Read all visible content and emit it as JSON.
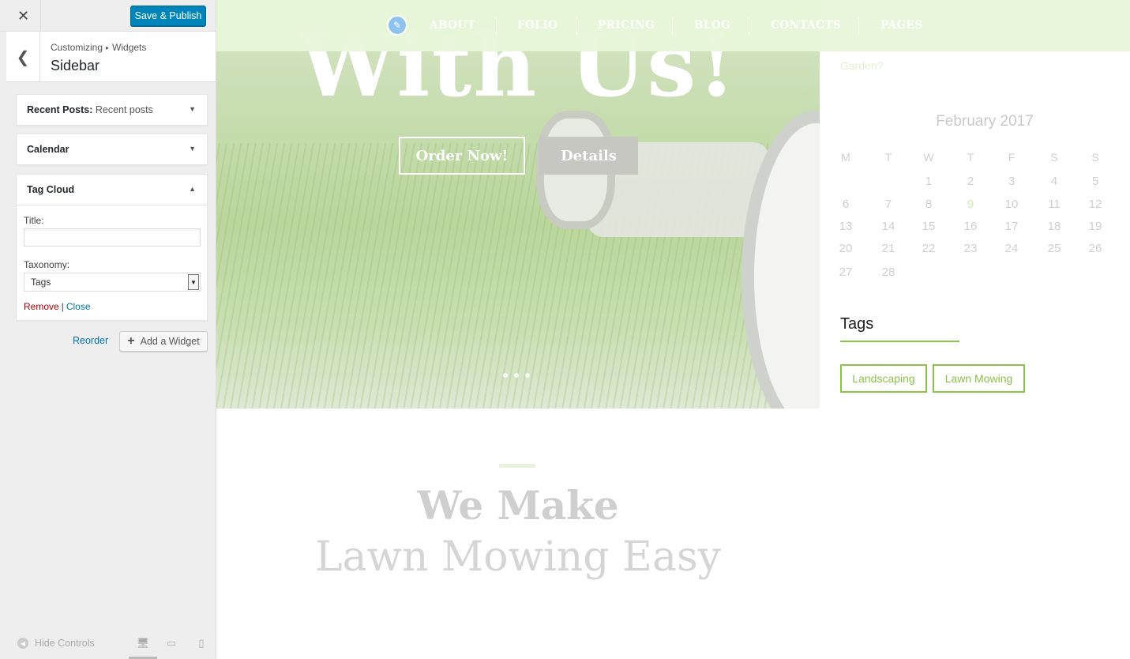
{
  "customizer": {
    "close_icon": "close-icon",
    "save_label": "Save & Publish",
    "breadcrumb": {
      "part1": "Customizing",
      "part2": "Widgets"
    },
    "section_title": "Sidebar",
    "widgets": [
      {
        "name": "Recent Posts:",
        "sub": "Recent posts",
        "expanded": false
      },
      {
        "name": "Calendar",
        "sub": "",
        "expanded": false
      },
      {
        "name": "Tag Cloud",
        "sub": "",
        "expanded": true
      }
    ],
    "tag_cloud": {
      "title_label": "Title:",
      "title_value": "",
      "taxonomy_label": "Taxonomy:",
      "taxonomy_value": "Tags",
      "remove_label": "Remove",
      "separator": "|",
      "close_label": "Close"
    },
    "reorder_label": "Reorder",
    "add_widget_label": "Add a Widget",
    "hide_controls_label": "Hide Controls"
  },
  "preview": {
    "nav": [
      "ABOUT",
      "FOLIO",
      "PRICING",
      "BLOG",
      "CONTACTS",
      "PAGES"
    ],
    "hero_heading": "With Us!",
    "order_label": "Order Now!",
    "details_label": "Details",
    "garden_link": "Garden?",
    "calendar": {
      "title": "February 2017",
      "weekdays": [
        "M",
        "T",
        "W",
        "T",
        "F",
        "S",
        "S"
      ],
      "weeks": [
        [
          "",
          "",
          "1",
          "2",
          "3",
          "4",
          "5"
        ],
        [
          "6",
          "7",
          "8",
          "9",
          "10",
          "11",
          "12"
        ],
        [
          "13",
          "14",
          "15",
          "16",
          "17",
          "18",
          "19"
        ],
        [
          "20",
          "21",
          "22",
          "23",
          "24",
          "25",
          "26"
        ],
        [
          "27",
          "28",
          "",
          "",
          "",
          "",
          ""
        ]
      ],
      "today": "9"
    },
    "tags_title": "Tags",
    "tags": [
      "Landscaping",
      "Lawn Mowing"
    ],
    "section_title": "We Make",
    "section_subtitle": "Lawn Mowing Easy"
  },
  "colors": {
    "primary_button": "#0085ba",
    "accent_green": "#8bc34a",
    "remove_red": "#aa0000",
    "link_blue": "#0073aa"
  }
}
